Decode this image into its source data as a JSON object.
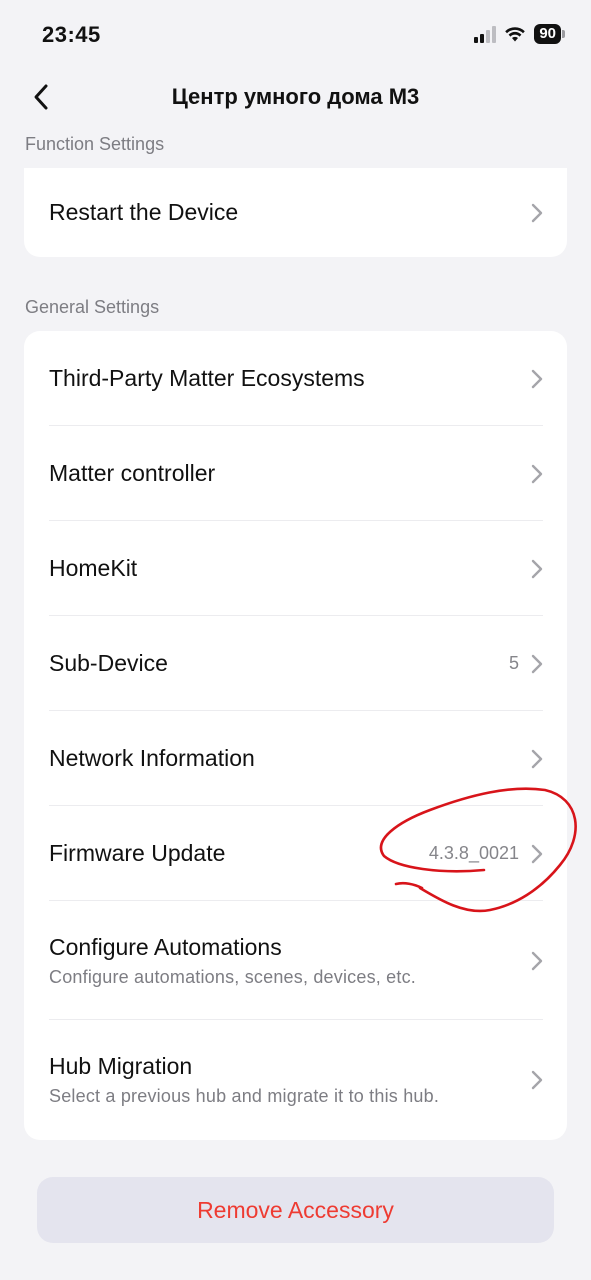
{
  "status_bar": {
    "time": "23:45",
    "battery": "90"
  },
  "nav": {
    "title": "Центр умного дома M3"
  },
  "sections": {
    "function_header": "Function Settings",
    "general_header": "General Settings"
  },
  "function_settings": {
    "restart_label": "Restart the Device"
  },
  "general_settings": {
    "items": [
      {
        "label": "Third-Party Matter Ecosystems"
      },
      {
        "label": "Matter controller"
      },
      {
        "label": "HomeKit"
      },
      {
        "label": "Sub-Device",
        "value": "5"
      },
      {
        "label": "Network Information"
      },
      {
        "label": "Firmware Update",
        "value": "4.3.8_0021"
      },
      {
        "label": "Configure Automations",
        "subtitle": "Configure automations, scenes, devices, etc."
      },
      {
        "label": "Hub Migration",
        "subtitle": "Select a previous hub and migrate it to this hub."
      }
    ]
  },
  "actions": {
    "remove_label": "Remove Accessory"
  },
  "colors": {
    "background": "#f3f3f6",
    "card": "#ffffff",
    "destructive": "#ee3b32",
    "annotation": "#d8141a"
  }
}
